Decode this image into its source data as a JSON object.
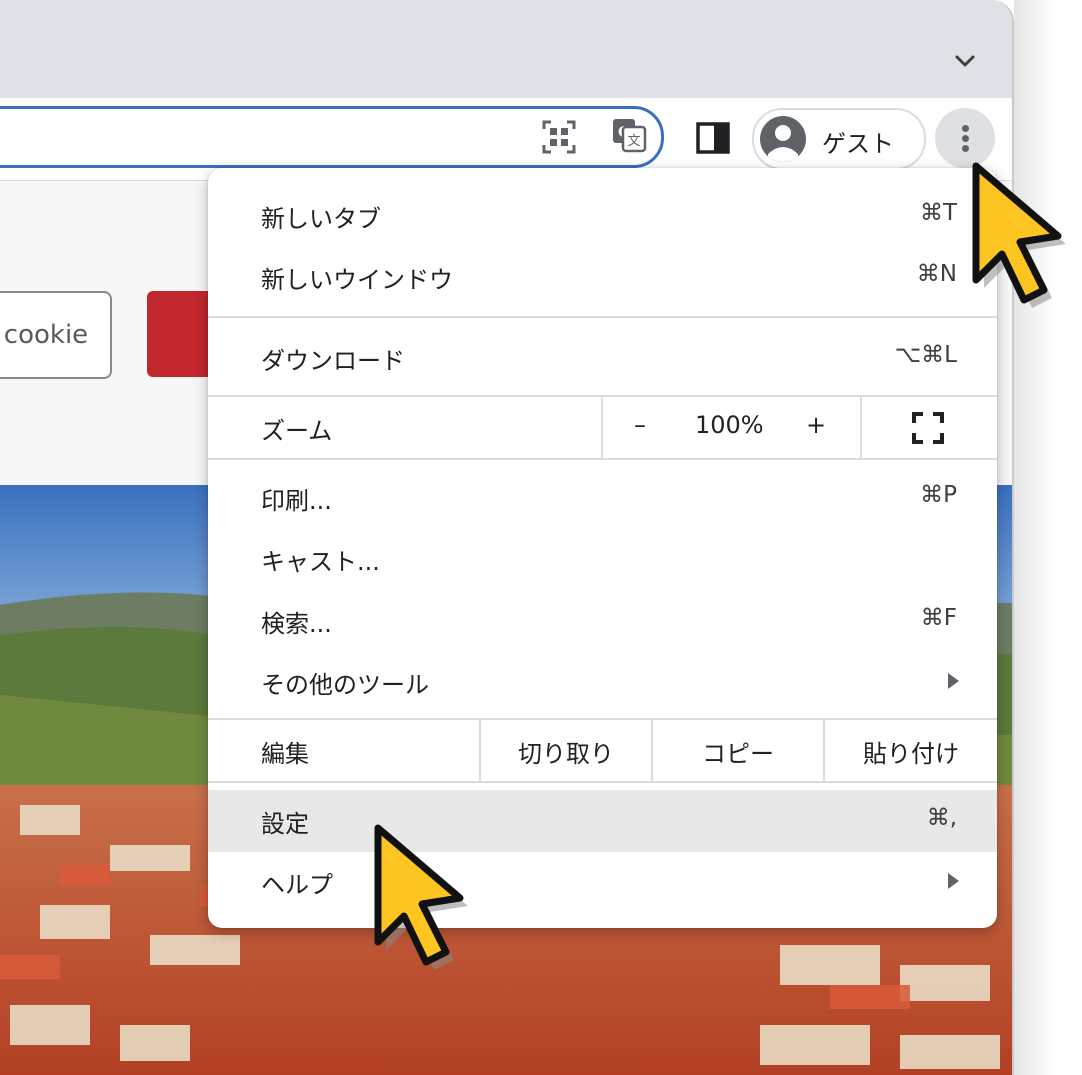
{
  "browser": {
    "profile": {
      "label": "ゲスト",
      "icon": "account-circle-icon"
    },
    "omnibox_icons": [
      "qr-code-icon",
      "translate-icon"
    ],
    "toolbar_icons": [
      "side-panel-icon",
      "more-vert-icon"
    ],
    "tab_dropdown_icon": "chevron-down-icon"
  },
  "page": {
    "cookie_button": "cookie"
  },
  "menu": {
    "new_tab": {
      "label": "新しいタブ",
      "shortcut": "⌘T"
    },
    "new_window": {
      "label": "新しいウインドウ",
      "shortcut": "⌘N"
    },
    "downloads": {
      "label": "ダウンロード",
      "shortcut": "⌥⌘L"
    },
    "zoom": {
      "label": "ズーム",
      "minus": "–",
      "value": "100%",
      "plus": "+",
      "fullscreen_icon": "fullscreen-icon"
    },
    "print": {
      "label": "印刷...",
      "shortcut": "⌘P"
    },
    "cast": {
      "label": "キャスト..."
    },
    "find": {
      "label": "検索...",
      "shortcut": "⌘F"
    },
    "more_tools": {
      "label": "その他のツール"
    },
    "edit": {
      "label": "編集",
      "cut": "切り取り",
      "copy": "コピー",
      "paste": "貼り付け"
    },
    "settings": {
      "label": "設定",
      "shortcut": "⌘,"
    },
    "help": {
      "label": "ヘルプ"
    }
  },
  "colors": {
    "omnibox_border": "#3b6fc2",
    "cursor_fill": "#fcc521",
    "highlight": "#e8e8e9"
  }
}
